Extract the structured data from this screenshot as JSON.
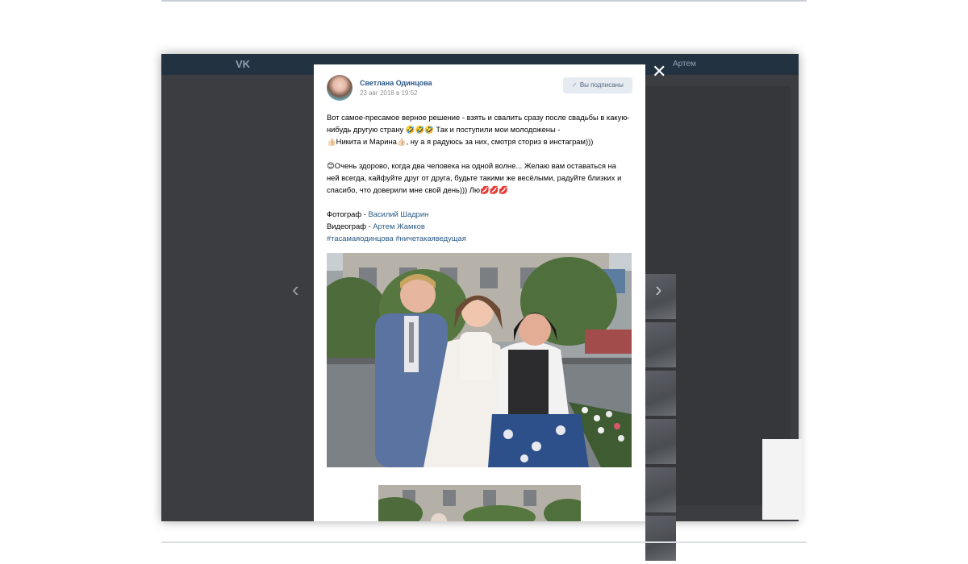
{
  "background_page": {
    "logo": "VK",
    "user_name": "Артем"
  },
  "post": {
    "author_name": "Светлана Одинцова",
    "date": "23 авг 2018 в 19:52",
    "subscribe_label": "Вы подписаны",
    "paragraph1_line1": "Вот самое-пресамое верное решение - взять и свалить сразу после свадьбы в какую-",
    "paragraph1_line2": "нибудь другую страну 🤣🤣🤣 Так и поступили мои молодожены -",
    "paragraph1_line3": "👍🏻Никита и Марина👍🏻, ну а я радуюсь за них, смотря сториз в инстаграм)))",
    "paragraph2_line1": "😊Очень здорово, когда два человека на одной волне... Желаю вам оставаться на",
    "paragraph2_line2": "ней всегда, кайфуйте друг от друга, будьте такими же весёлыми, радуйте близких и",
    "paragraph2_line3": "спасибо, что доверили мне свой день))) Лю💋💋💋",
    "photographer_label": "Фотограф - ",
    "photographer_name": "Василий Шадрин",
    "videographer_label": "Видеограф - ",
    "videographer_name": "Артем Жамков",
    "hashtags": "#тасамаяодинцова #ничетакаяведущая"
  },
  "navigation": {
    "prev_arrow": "‹",
    "next_arrow": "›",
    "close": "✕"
  },
  "colors": {
    "link": "#2a5885",
    "overlay": "#3b3d41",
    "header": "#233241"
  }
}
